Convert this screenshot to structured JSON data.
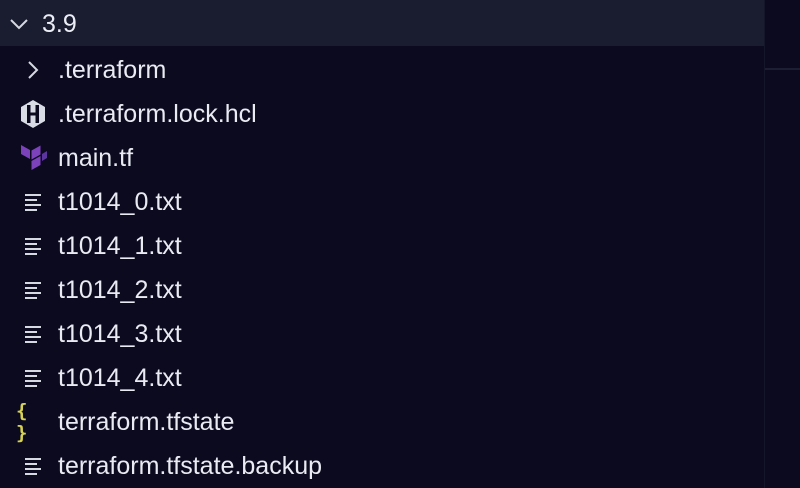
{
  "folder": {
    "name": "3.9",
    "expanded": true,
    "icon": "chevron-down-icon"
  },
  "items": [
    {
      "label": ".terraform",
      "icon": "chevron-right-icon",
      "kind": "folder"
    },
    {
      "label": ".terraform.lock.hcl",
      "icon": "hashicorp-icon",
      "kind": "file"
    },
    {
      "label": "main.tf",
      "icon": "terraform-icon",
      "kind": "file"
    },
    {
      "label": "t1014_0.txt",
      "icon": "text-file-icon",
      "kind": "file"
    },
    {
      "label": "t1014_1.txt",
      "icon": "text-file-icon",
      "kind": "file"
    },
    {
      "label": "t1014_2.txt",
      "icon": "text-file-icon",
      "kind": "file"
    },
    {
      "label": "t1014_3.txt",
      "icon": "text-file-icon",
      "kind": "file"
    },
    {
      "label": "t1014_4.txt",
      "icon": "text-file-icon",
      "kind": "file"
    },
    {
      "label": "terraform.tfstate",
      "icon": "json-braces-icon",
      "kind": "file",
      "icon_text": "{ }"
    },
    {
      "label": "terraform.tfstate.backup",
      "icon": "text-file-icon",
      "kind": "file"
    }
  ],
  "colors": {
    "background": "#0b0a1f",
    "header_background": "#1a1c30",
    "text": "#e9eaf2",
    "terraform_purple": "#7b42bc",
    "json_yellow": "#d7d253"
  }
}
